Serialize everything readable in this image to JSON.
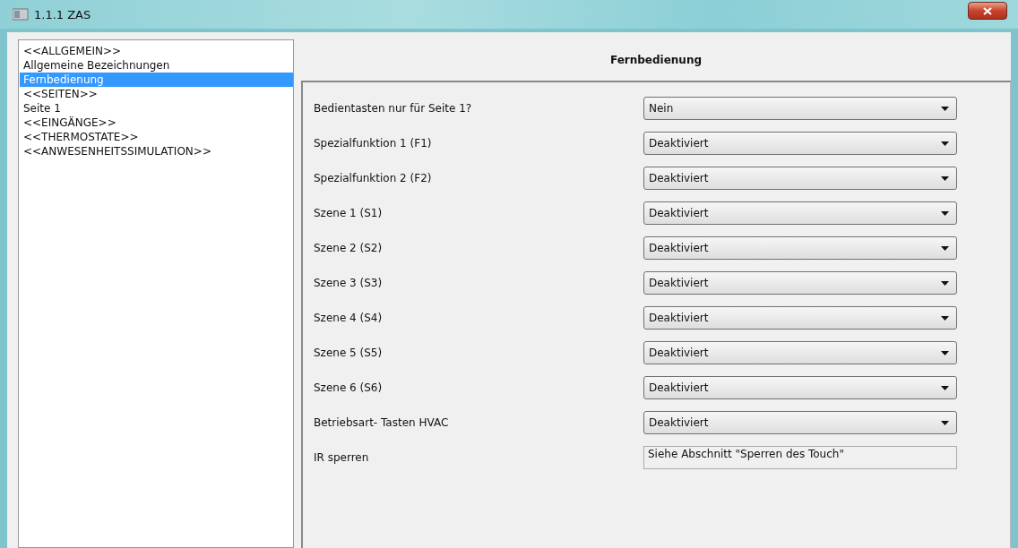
{
  "window": {
    "title": "1.1.1 ZAS"
  },
  "sidebar": {
    "items": [
      {
        "label": "<<ALLGEMEIN>>",
        "selected": false
      },
      {
        "label": "Allgemeine Bezeichnungen",
        "selected": false
      },
      {
        "label": "Fernbedienung",
        "selected": true
      },
      {
        "label": "<<SEITEN>>",
        "selected": false
      },
      {
        "label": "Seite 1",
        "selected": false
      },
      {
        "label": "<<EINGÄNGE>>",
        "selected": false
      },
      {
        "label": "<<THERMOSTATE>>",
        "selected": false
      },
      {
        "label": "<<ANWESENHEITSSIMULATION>>",
        "selected": false
      }
    ]
  },
  "panel": {
    "title": "Fernbedienung",
    "rows": [
      {
        "label": "Bedientasten nur für Seite 1?",
        "kind": "dropdown",
        "value": "Nein"
      },
      {
        "label": "Spezialfunktion 1 (F1)",
        "kind": "dropdown",
        "value": "Deaktiviert"
      },
      {
        "label": "Spezialfunktion 2 (F2)",
        "kind": "dropdown",
        "value": "Deaktiviert"
      },
      {
        "label": "Szene 1 (S1)",
        "kind": "dropdown",
        "value": "Deaktiviert"
      },
      {
        "label": "Szene 2 (S2)",
        "kind": "dropdown",
        "value": "Deaktiviert"
      },
      {
        "label": "Szene 3 (S3)",
        "kind": "dropdown",
        "value": "Deaktiviert"
      },
      {
        "label": "Szene 4 (S4)",
        "kind": "dropdown",
        "value": "Deaktiviert"
      },
      {
        "label": "Szene 5 (S5)",
        "kind": "dropdown",
        "value": "Deaktiviert"
      },
      {
        "label": "Szene 6 (S6)",
        "kind": "dropdown",
        "value": "Deaktiviert"
      },
      {
        "label": "Betriebsart- Tasten HVAC",
        "kind": "dropdown",
        "value": "Deaktiviert"
      },
      {
        "label": "IR sperren",
        "kind": "text",
        "value": "Siehe Abschnitt \"Sperren des Touch\""
      }
    ]
  }
}
